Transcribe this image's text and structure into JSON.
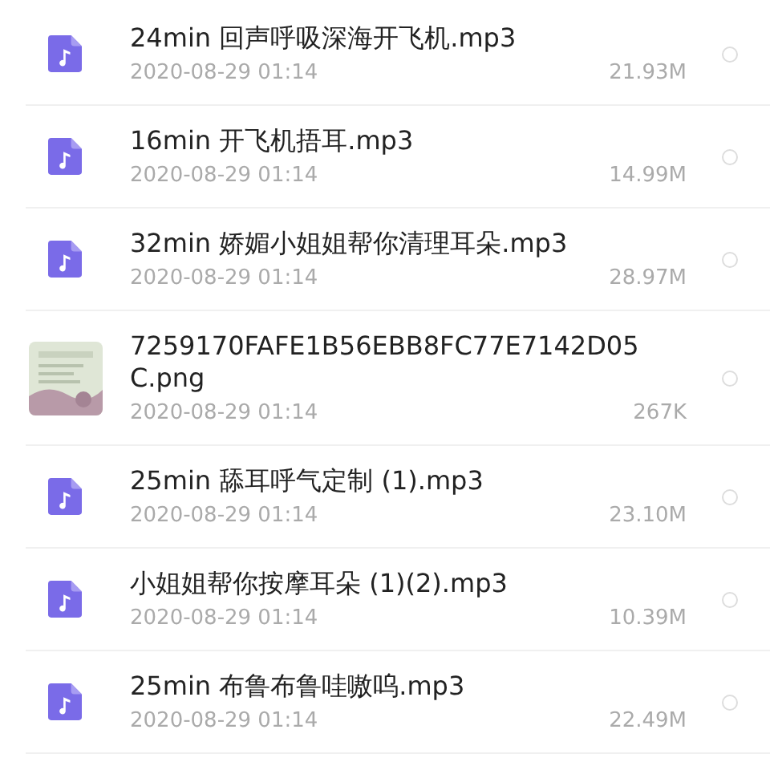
{
  "files": [
    {
      "kind": "audio",
      "name": "24min 回声呼吸深海开飞机.mp3",
      "date": "2020-08-29 01:14",
      "size": "21.93M",
      "selected": false
    },
    {
      "kind": "audio",
      "name": "16min 开飞机捂耳.mp3",
      "date": "2020-08-29 01:14",
      "size": "14.99M",
      "selected": false
    },
    {
      "kind": "audio",
      "name": "32min 娇媚小姐姐帮你清理耳朵.mp3",
      "date": "2020-08-29 01:14",
      "size": "28.97M",
      "selected": false
    },
    {
      "name": "7259170FAFE1B56EBB8FC77E7142D05C.png",
      "date": "2020-08-29 01:14",
      "size": "267K",
      "selected": false
    },
    {
      "kind": "audio",
      "name": "25min 舔耳呼气定制 (1).mp3",
      "date": "2020-08-29 01:14",
      "size": "23.10M",
      "selected": false
    },
    {
      "kind": "audio",
      "name": "小姐姐帮你按摩耳朵 (1)(2).mp3",
      "date": "2020-08-29 01:14",
      "size": "10.39M",
      "selected": false
    },
    {
      "kind": "audio",
      "name": "25min 布鲁布鲁哇嗷呜.mp3",
      "date": "2020-08-29 01:14",
      "size": "22.49M",
      "selected": false
    }
  ]
}
